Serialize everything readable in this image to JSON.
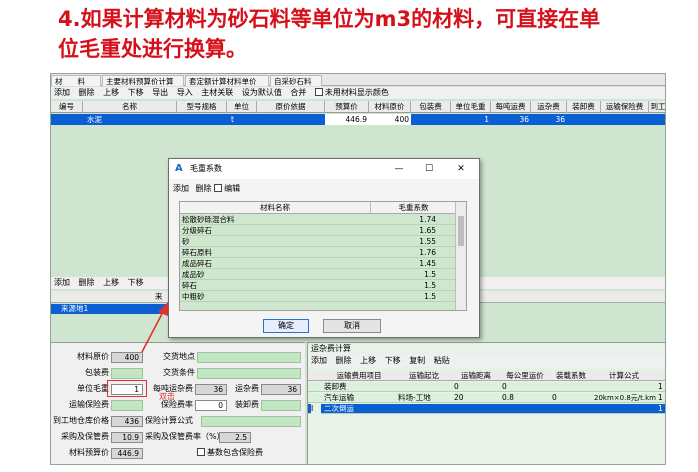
{
  "heading": {
    "line1": "4.如果计算材料为砂石料等单位为m3的材料，可直接在单",
    "line2": "位毛重处进行换算。"
  },
  "tabs": [
    "材　　料",
    "主要材料预算价计算",
    "套定额计算材料单价",
    "自采砂石料"
  ],
  "toolbar": {
    "items": [
      "添加",
      "删除",
      "上移",
      "下移",
      "导出",
      "导入",
      "主材关联",
      "设为默认值",
      "合并"
    ],
    "checkbox_label": "未用材料显示颜色"
  },
  "grid": {
    "columns": [
      "编号",
      "名称",
      "型号规格",
      "单位",
      "原价依据",
      "预算价",
      "材料原价",
      "包装费",
      "单位毛重",
      "每吨运费",
      "运杂费",
      "装卸费",
      "运输保险费",
      "到工"
    ],
    "row": {
      "name": "水泥",
      "unit": "t",
      "price": "446.9",
      "original": "400",
      "weight": "1",
      "per_ton": "36",
      "misc": "36"
    }
  },
  "toolbar2": {
    "items": [
      "添加",
      "删除",
      "上移",
      "下移"
    ]
  },
  "mid": {
    "header": "来",
    "row": "来源地1"
  },
  "form": {
    "labels": {
      "original": "材料原价",
      "pack": "包装费",
      "weight": "单位毛重",
      "insure": "运输保险费",
      "arrival": "到工地仓库价格",
      "procure": "采购及保管费",
      "budget": "材料预算价",
      "place": "交货地点",
      "cond": "交货条件",
      "per_ton": "每吨运杂费",
      "misc": "运杂费",
      "ins_rate": "保险费率",
      "load": "装卸费",
      "ins_formula": "保险计算公式",
      "proc_rate": "采购及保管费率（%）",
      "base_check": "基数包含保险费"
    },
    "values": {
      "original": "400",
      "weight": "1",
      "per_ton": "36",
      "misc": "36",
      "ins_rate": "0",
      "arrival": "436",
      "procure": "10.9",
      "proc_rate": "2.5",
      "budget": "446.9"
    }
  },
  "annotation": {
    "click": "双击"
  },
  "fee": {
    "title": "运杂费计算",
    "toolbar": [
      "添加",
      "删除",
      "上移",
      "下移",
      "复制",
      "粘贴"
    ],
    "columns": [
      "运输费用项目",
      "运输起讫",
      "运输距离",
      "每公里运价",
      "装载系数",
      "计算公式"
    ],
    "rows": [
      {
        "item": "装卸费",
        "route": "",
        "dist": "0",
        "rate": "0",
        "load": "",
        "formula": "",
        "extra": "1"
      },
      {
        "item": "汽车运输",
        "route": "料场-工地",
        "dist": "20",
        "rate": "0.8",
        "load": "0",
        "formula": "20km×0.8元/t.km",
        "extra": "1"
      },
      {
        "item": "二次倒运",
        "route": "",
        "dist": "",
        "rate": "",
        "load": "",
        "formula": "",
        "extra": "1"
      }
    ],
    "row_marker": "I"
  },
  "dialog": {
    "title": "毛重系数",
    "toolbar": [
      "添加",
      "删除"
    ],
    "edit_label": "编辑",
    "columns": [
      "材料名称",
      "毛重系数"
    ],
    "rows": [
      {
        "name": "松散砂砾混合料",
        "value": "1.74"
      },
      {
        "name": "分级碎石",
        "value": "1.65"
      },
      {
        "name": "砂",
        "value": "1.55"
      },
      {
        "name": "碎石原料",
        "value": "1.76"
      },
      {
        "name": "成品碎石",
        "value": "1.45"
      },
      {
        "name": "成品砂",
        "value": "1.5"
      },
      {
        "name": "碎石",
        "value": "1.5"
      },
      {
        "name": "中粗砂",
        "value": "1.5"
      }
    ],
    "ok": "确定",
    "cancel": "取消"
  }
}
